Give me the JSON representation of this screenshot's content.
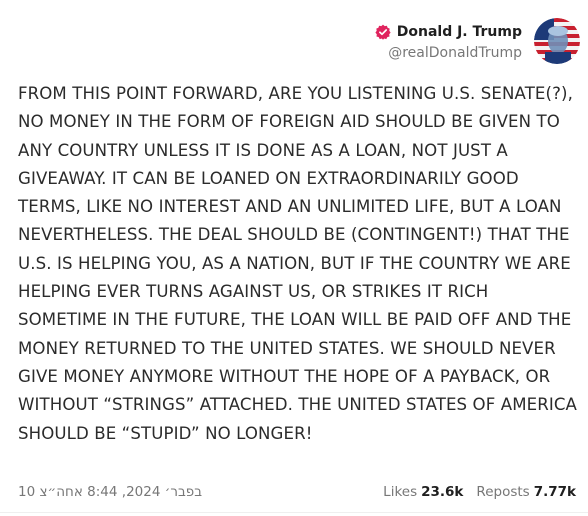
{
  "account": {
    "display_name": "Donald J. Trump",
    "handle": "@realDonaldTrump",
    "verified_icon": "verified-badge-icon",
    "accent_color": "#e0245e"
  },
  "post": {
    "text": "FROM THIS POINT FORWARD, ARE YOU LISTENING U.S. SENATE(?), NO MONEY IN THE FORM OF FOREIGN AID SHOULD BE GIVEN TO ANY COUNTRY UNLESS IT IS DONE AS A LOAN, NOT JUST A GIVEAWAY. IT CAN BE LOANED ON EXTRAORDINARILY GOOD TERMS, LIKE NO INTEREST AND AN UNLIMITED LIFE, BUT A LOAN NEVERTHELESS. THE DEAL SHOULD BE (CONTINGENT!) THAT THE U.S. IS HELPING YOU, AS A NATION, BUT IF THE COUNTRY WE ARE HELPING EVER TURNS AGAINST US, OR STRIKES IT RICH SOMETIME IN THE FUTURE, THE LOAN WILL BE PAID OFF AND THE MONEY RETURNED TO THE UNITED STATES. WE SHOULD NEVER GIVE MONEY ANYMORE WITHOUT THE HOPE OF A PAYBACK, OR WITHOUT “STRINGS” ATTACHED. THE UNITED STATES OF AMERICA SHOULD BE “STUPID” NO LONGER!"
  },
  "footer": {
    "timestamp": "10 בפבר׳ 2024, 8:44 אחה״צ",
    "likes_label": "Likes",
    "likes_value": "23.6k",
    "reposts_label": "Reposts",
    "reposts_value": "7.77k"
  }
}
